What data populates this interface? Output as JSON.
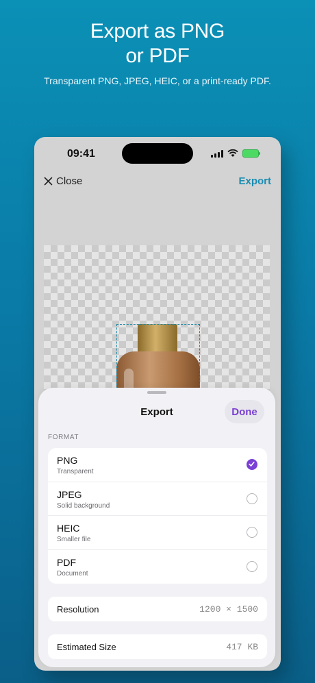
{
  "hero": {
    "title_line1": "Export as PNG",
    "title_line2": "or PDF",
    "subtitle": "Transparent PNG, JPEG, HEIC, or a print-ready PDF."
  },
  "status_bar": {
    "time": "09:41",
    "icons": [
      "signal-icon",
      "wifi-icon",
      "battery-charging-icon"
    ],
    "battery_color": "#4cd964"
  },
  "nav": {
    "close_label": "Close",
    "export_label": "Export",
    "accent_color": "#1a8db2"
  },
  "sheet": {
    "title": "Export",
    "done_label": "Done",
    "done_color": "#7a3fd1",
    "section_label": "FORMAT",
    "formats": [
      {
        "name": "PNG",
        "description": "Transparent",
        "selected": true
      },
      {
        "name": "JPEG",
        "description": "Solid background",
        "selected": false
      },
      {
        "name": "HEIC",
        "description": "Smaller file",
        "selected": false
      },
      {
        "name": "PDF",
        "description": "Document",
        "selected": false
      }
    ],
    "resolution": {
      "label": "Resolution",
      "value": "1200 × 1500"
    },
    "estimated_size": {
      "label": "Estimated Size",
      "value": "417 KB"
    }
  }
}
